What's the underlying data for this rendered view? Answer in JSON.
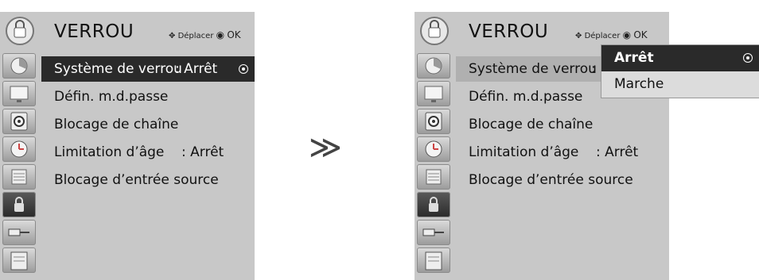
{
  "left_panel": {
    "title": "VERROU",
    "hint_move": "Déplacer",
    "hint_ok": "OK",
    "items": [
      {
        "label": "Système de verrou",
        "value": ": Arrêt"
      },
      {
        "label": "Défin. m.d.passe",
        "value": ""
      },
      {
        "label": "Blocage de chaîne",
        "value": ""
      },
      {
        "label": "Limitation d’âge",
        "value": ": Arrêt"
      },
      {
        "label": "Blocage d’entrée source",
        "value": ""
      }
    ]
  },
  "arrow": "≫",
  "right_panel": {
    "title": "VERROU",
    "hint_move": "Déplacer",
    "hint_ok": "OK",
    "items": [
      {
        "label": "Système de verrou",
        "value": ":"
      },
      {
        "label": "Défin. m.d.passe",
        "value": ""
      },
      {
        "label": "Blocage de chaîne",
        "value": ""
      },
      {
        "label": "Limitation d’âge",
        "value": ": Arrêt"
      },
      {
        "label": "Blocage d’entrée source",
        "value": ""
      }
    ],
    "popup_options": [
      "Arrêt",
      "Marche"
    ],
    "popup_selected": "Arrêt"
  },
  "sidebar_icons": [
    "setup-icon",
    "picture-icon",
    "audio-icon",
    "time-icon",
    "option-icon",
    "lock-icon",
    "input-icon",
    "usb-icon"
  ],
  "colors": {
    "panel_bg": "#c8c8c8",
    "highlight_bg": "#2a2a2a",
    "highlight_text": "#ffffff"
  }
}
